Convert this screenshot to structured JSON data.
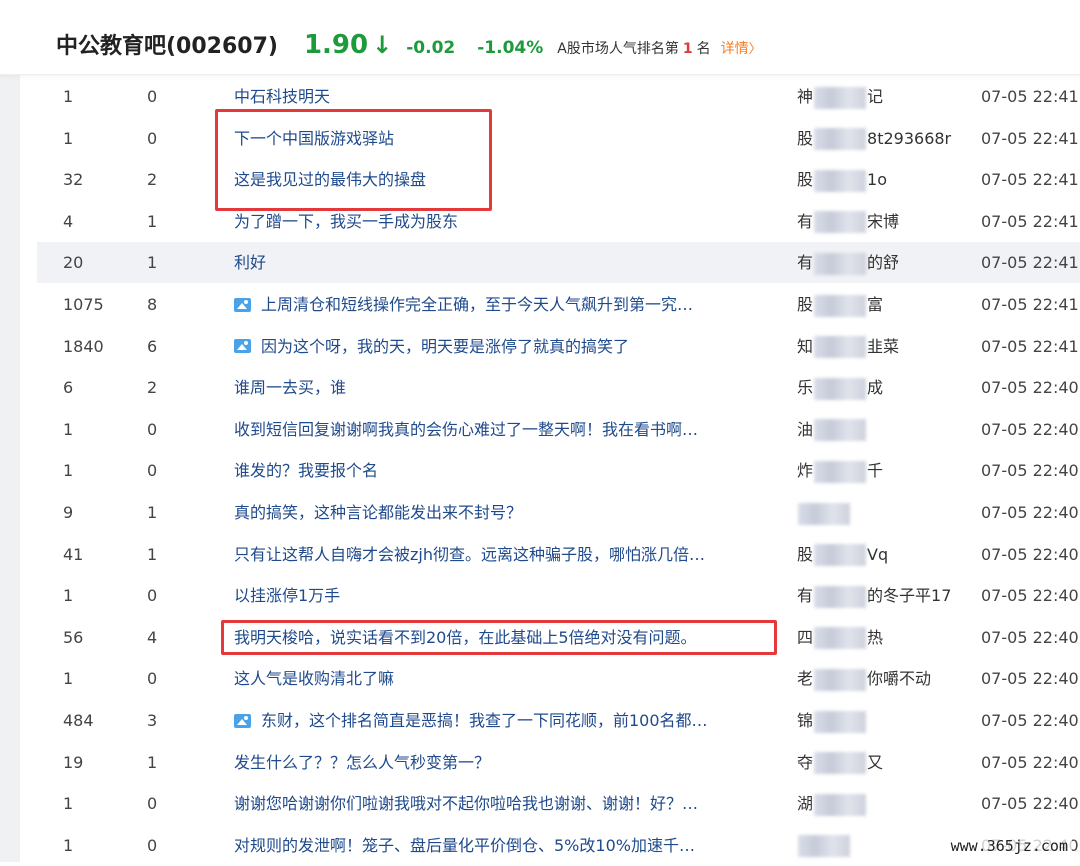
{
  "header": {
    "title": "中公教育吧(002607)",
    "price": "1.90",
    "price_arrow": "↓",
    "change": "-0.02",
    "change_pct": "-1.04%",
    "rank_prefix": "A股市场人气排名第",
    "rank_number": "1",
    "rank_suffix": "名",
    "detail_label": "详情",
    "detail_chevron": "〉",
    "down_color": "#1d9b3c",
    "accent_color": "#f57e22"
  },
  "posts": [
    {
      "reads": "1",
      "replies": "0",
      "title": "中石科技明天",
      "author_a": "神",
      "author_b": "记",
      "time": "07-05 22:41",
      "has_image": false
    },
    {
      "reads": "1",
      "replies": "0",
      "title": "下一个中国版游戏驿站",
      "author_a": "股",
      "author_b": "8t293668r",
      "time": "07-05 22:41",
      "has_image": false
    },
    {
      "reads": "32",
      "replies": "2",
      "title": "这是我见过的最伟大的操盘",
      "author_a": "股",
      "author_b": "1o",
      "time": "07-05 22:41",
      "has_image": false
    },
    {
      "reads": "4",
      "replies": "1",
      "title": "为了蹭一下，我买一手成为股东",
      "author_a": "有",
      "author_b": "宋博",
      "time": "07-05 22:41",
      "has_image": false
    },
    {
      "reads": "20",
      "replies": "1",
      "title": "利好",
      "author_a": "有",
      "author_b": "的舒",
      "time": "07-05 22:41",
      "has_image": false
    },
    {
      "reads": "1075",
      "replies": "8",
      "title": "上周清仓和短线操作完全正确，至于今天人气飙升到第一究…",
      "author_a": "股",
      "author_b": "富",
      "time": "07-05 22:41",
      "has_image": true
    },
    {
      "reads": "1840",
      "replies": "6",
      "title": "因为这个呀，我的天，明天要是涨停了就真的搞笑了",
      "author_a": "知",
      "author_b": "韭菜",
      "time": "07-05 22:41",
      "has_image": true
    },
    {
      "reads": "6",
      "replies": "2",
      "title": "谁周一去买，谁",
      "author_a": "乐",
      "author_b": "成",
      "time": "07-05 22:40",
      "has_image": false
    },
    {
      "reads": "1",
      "replies": "0",
      "title": "收到短信回复谢谢啊我真的会伤心难过了一整天啊！我在看书啊…",
      "author_a": "油",
      "author_b": "",
      "time": "07-05 22:40",
      "has_image": false
    },
    {
      "reads": "1",
      "replies": "0",
      "title": "谁发的？我要报个名",
      "author_a": "炸",
      "author_b": "千",
      "time": "07-05 22:40",
      "has_image": false
    },
    {
      "reads": "9",
      "replies": "1",
      "title": "真的搞笑，这种言论都能发出来不封号？",
      "author_a": "",
      "author_b": "",
      "time": "07-05 22:40",
      "has_image": false
    },
    {
      "reads": "41",
      "replies": "1",
      "title": "只有让这帮人自嗨才会被zjh彻查。远离这种骗子股，哪怕涨几倍…",
      "author_a": "股",
      "author_b": "Vq",
      "time": "07-05 22:40",
      "has_image": false
    },
    {
      "reads": "1",
      "replies": "0",
      "title": "以挂涨停1万手",
      "author_a": "有",
      "author_b": "的冬子平17",
      "time": "07-05 22:40",
      "has_image": false
    },
    {
      "reads": "56",
      "replies": "4",
      "title": "我明天梭哈，说实话看不到20倍，在此基础上5倍绝对没有问题。",
      "author_a": "四",
      "author_b": "热",
      "time": "07-05 22:40",
      "has_image": false
    },
    {
      "reads": "1",
      "replies": "0",
      "title": "这人气是收购清北了嘛",
      "author_a": "老",
      "author_b": "你嚼不动",
      "time": "07-05 22:40",
      "has_image": false
    },
    {
      "reads": "484",
      "replies": "3",
      "title": "东财，这个排名简直是恶搞！我查了一下同花顺，前100名都…",
      "author_a": "锦",
      "author_b": "",
      "time": "07-05 22:40",
      "has_image": true
    },
    {
      "reads": "19",
      "replies": "1",
      "title": "发生什么了？？怎么人气秒变第一？",
      "author_a": "夺",
      "author_b": "又",
      "time": "07-05 22:40",
      "has_image": false
    },
    {
      "reads": "1",
      "replies": "0",
      "title": "谢谢您哈谢谢你们啦谢我哦对不起你啦哈我也谢谢、谢谢！好？…",
      "author_a": "湖",
      "author_b": "",
      "time": "07-05 22:40",
      "has_image": false
    },
    {
      "reads": "1",
      "replies": "0",
      "title": "对规则的发泄啊！笼子、盘后量化平价倒仓、5%改10%加速千…",
      "author_a": "",
      "author_b": "",
      "time": "07-05 22:40",
      "has_image": false
    }
  ],
  "watermark": "www.365jz.com"
}
